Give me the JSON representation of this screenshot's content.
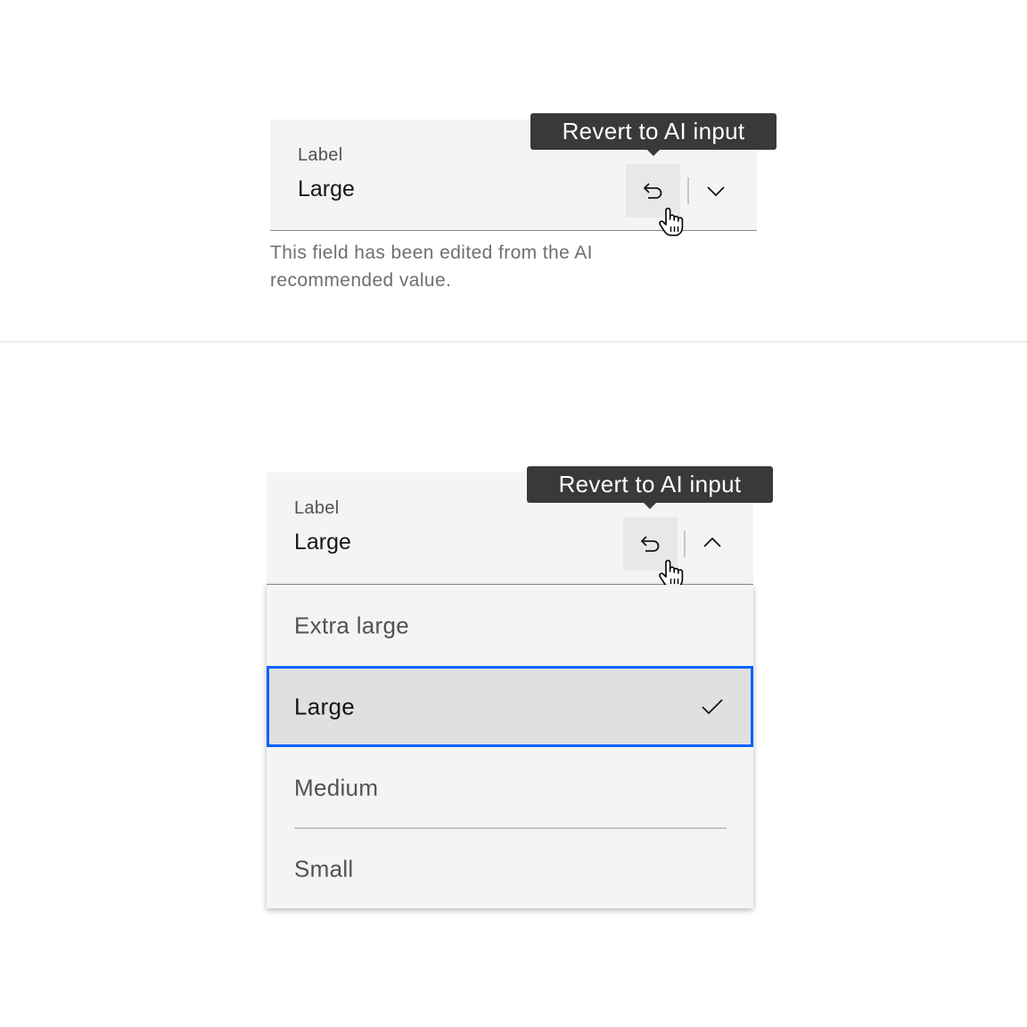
{
  "example_closed": {
    "label": "Label",
    "value": "Large",
    "tooltip": "Revert to AI input",
    "helper_text": "This field has been edited from the AI recommended value.",
    "revert_icon": "undo-arrow-icon",
    "chevron_icon": "chevron-down-icon",
    "cursor_icon": "pointer-hand-cursor-icon"
  },
  "example_open": {
    "label": "Label",
    "value": "Large",
    "tooltip": "Revert to AI input",
    "revert_icon": "undo-arrow-icon",
    "chevron_icon": "chevron-up-icon",
    "cursor_icon": "pointer-hand-cursor-icon",
    "options": [
      {
        "label": "Extra large",
        "selected": false
      },
      {
        "label": "Large",
        "selected": true
      },
      {
        "label": "Medium",
        "selected": false
      },
      {
        "label": "Small",
        "selected": false
      }
    ],
    "selected_icon": "checkmark-icon"
  },
  "colors": {
    "field_bg": "#f4f4f4",
    "tooltip_bg": "#393939",
    "focus_border": "#0f62fe",
    "selected_bg": "#e0e0e0"
  }
}
